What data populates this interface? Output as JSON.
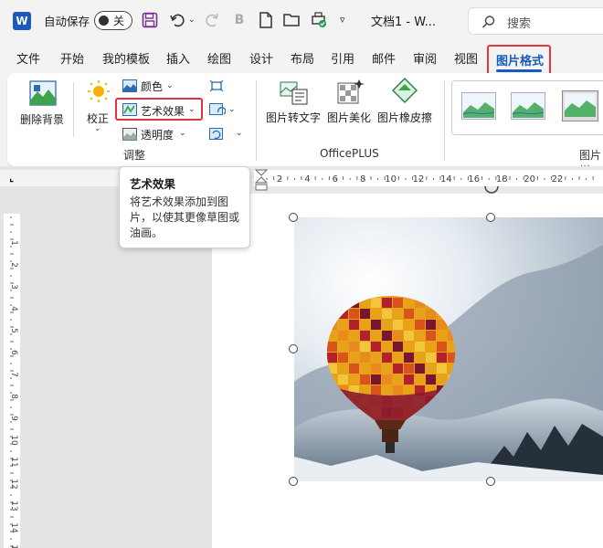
{
  "titlebar": {
    "logo": "W",
    "autosave_label": "自动保存",
    "toggle_state": "关",
    "doc_title": "文档1 - W...",
    "search_placeholder": "搜索"
  },
  "tabs": [
    {
      "label": "文件"
    },
    {
      "label": "开始"
    },
    {
      "label": "我的模板"
    },
    {
      "label": "插入"
    },
    {
      "label": "绘图"
    },
    {
      "label": "设计"
    },
    {
      "label": "布局"
    },
    {
      "label": "引用"
    },
    {
      "label": "邮件"
    },
    {
      "label": "审阅"
    },
    {
      "label": "视图"
    }
  ],
  "active_tab": "图片格式",
  "ribbon": {
    "remove_bg": "删除背景",
    "correct": "校正",
    "color": "颜色",
    "artistic": "艺术效果",
    "transparency": "透明度",
    "group_adjust": "调整",
    "pic_to_text": "图片转文字",
    "pic_beautify": "图片美化",
    "pic_eraser": "图片橡皮擦",
    "group_officeplus": "OfficePLUS",
    "group_styles_partial": "图片样"
  },
  "tooltip": {
    "title": "艺术效果",
    "desc": "将艺术效果添加到图片，以使其更像草图或油画。"
  },
  "ruler": {
    "h_ticks": [
      "2",
      "4",
      "6",
      "8",
      "10",
      "12",
      "14",
      "16",
      "18",
      "20",
      "22"
    ],
    "v_ticks": [
      "1",
      "2",
      "3",
      "4",
      "5",
      "6",
      "7",
      "8",
      "9",
      "10",
      "11",
      "12",
      "13",
      "14",
      "15"
    ]
  },
  "colors": {
    "accent": "#185abd",
    "highlight": "#e0363b"
  }
}
